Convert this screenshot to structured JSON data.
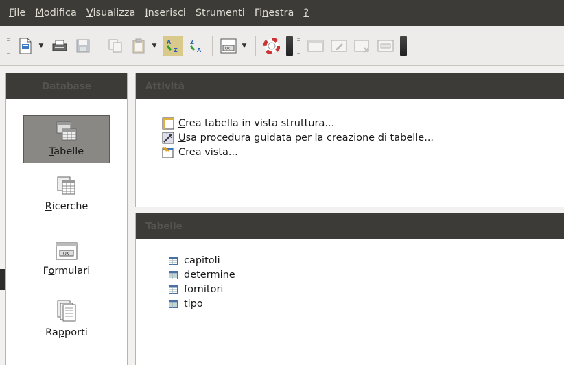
{
  "menubar": {
    "items": [
      {
        "pre": "",
        "u": "F",
        "post": "ile"
      },
      {
        "pre": "",
        "u": "M",
        "post": "odifica"
      },
      {
        "pre": "",
        "u": "V",
        "post": "isualizza"
      },
      {
        "pre": "",
        "u": "I",
        "post": "nserisci"
      },
      {
        "pre": "Strumenti",
        "u": "",
        "post": ""
      },
      {
        "pre": "Fi",
        "u": "n",
        "post": "estra"
      },
      {
        "pre": "",
        "u": "?",
        "post": ""
      }
    ]
  },
  "toolbar": {
    "icons": [
      "new-document-icon",
      "print-icon",
      "save-icon",
      "copy-icon",
      "paste-icon",
      "sort-ascending-icon",
      "sort-descending-icon",
      "form-control-icon",
      "help-lifebuoy-icon",
      "open-icon",
      "edit-icon",
      "delete-icon",
      "rename-icon"
    ],
    "accent_pressed": "#d9c98a"
  },
  "left": {
    "header": "Database",
    "items": [
      {
        "pre": "",
        "u": "T",
        "post": "abelle"
      },
      {
        "pre": "",
        "u": "R",
        "post": "icerche"
      },
      {
        "pre": "F",
        "u": "o",
        "post": "rmulari"
      },
      {
        "pre": "Ra",
        "u": "p",
        "post": "porti"
      }
    ]
  },
  "tasks": {
    "header": "Attività",
    "items": [
      {
        "pre": "",
        "u": "C",
        "post": "rea tabella in vista struttura..."
      },
      {
        "pre": "",
        "u": "U",
        "post": "sa procedura guidata per la creazione di tabelle..."
      },
      {
        "pre": "Crea vi",
        "u": "s",
        "post": "ta..."
      }
    ]
  },
  "tables": {
    "header": "Tabelle",
    "items": [
      "capitoli",
      "determine",
      "fornitori",
      "tipo"
    ]
  },
  "colors": {
    "menubar_bg": "#3c3b37",
    "panel_header_bg": "#3c3b37",
    "selected_bg": "#8a8884"
  }
}
